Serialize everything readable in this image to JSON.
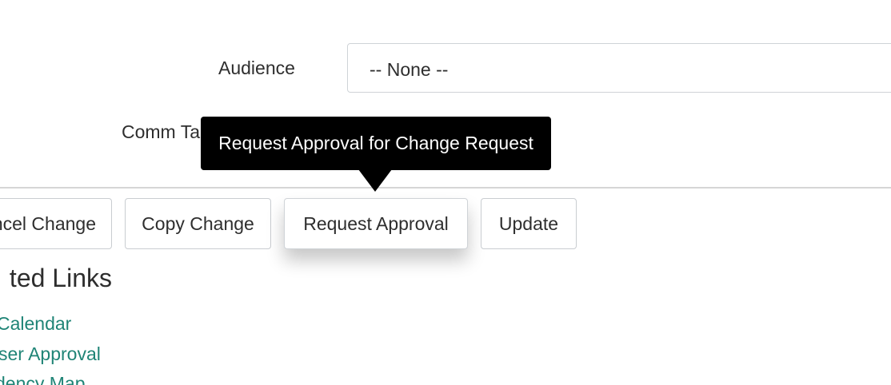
{
  "form": {
    "audience_label": "Audience",
    "audience_value": "-- None --",
    "comm_label": "Comm Ta"
  },
  "tooltip": {
    "text": "Request Approval for Change Request"
  },
  "actions": {
    "cancel_label": "ncel Change",
    "copy_label": "Copy Change",
    "request_label": "Request Approval",
    "update_label": "Update"
  },
  "related": {
    "heading": "ted Links",
    "links": [
      "Calendar",
      "ser Approval",
      "dency Map"
    ]
  },
  "colors": {
    "link": "#1f8476",
    "tooltip_bg": "#000000",
    "text": "#2e2e2e"
  }
}
